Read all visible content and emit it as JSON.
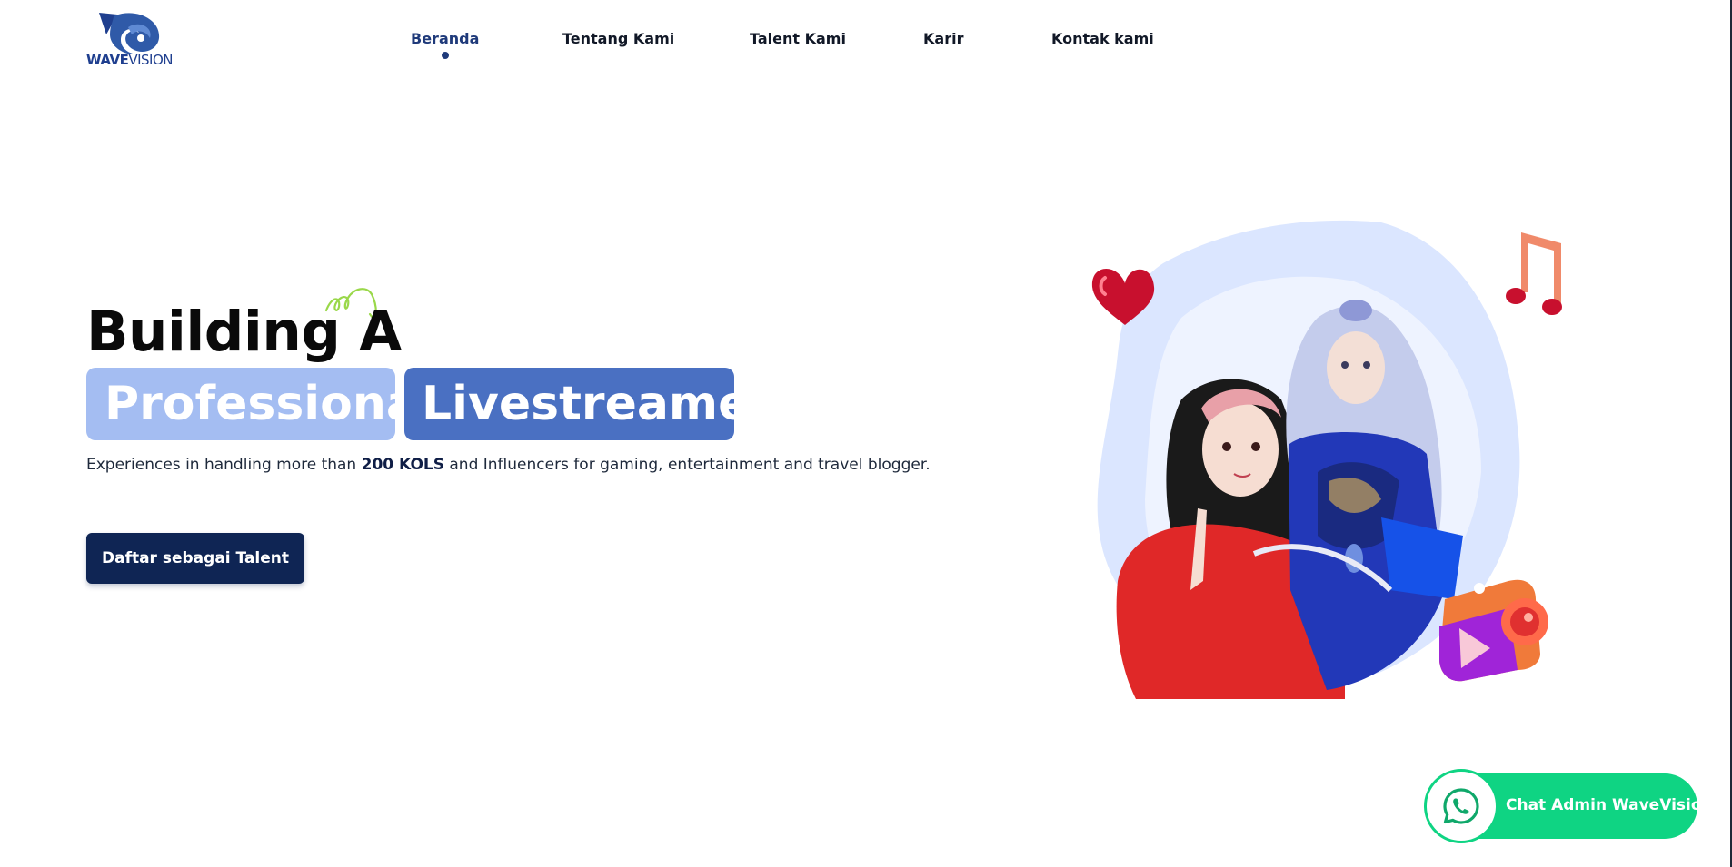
{
  "brand": {
    "logo_bold": "WAVE",
    "logo_light": "VISION",
    "color_primary": "#1f3a7a"
  },
  "nav": {
    "items": [
      {
        "label": "Beranda",
        "active": true
      },
      {
        "label": "Tentang Kami",
        "active": false
      },
      {
        "label": "Talent Kami",
        "active": false
      },
      {
        "label": "Karir",
        "active": false
      },
      {
        "label": "Kontak kami",
        "active": false
      }
    ]
  },
  "hero": {
    "title": "Building A",
    "tag_1": "Professional",
    "tag_2": "Livestreamer",
    "subtitle_pre": "Experiences in handling more than ",
    "subtitle_bold": "200 KOLS",
    "subtitle_post": " and Influencers for gaming, entertainment and travel blogger.",
    "cta_label": "Daftar sebagai Talent",
    "tag_1_color": "#a4bdf2",
    "tag_2_color": "#4a70c2",
    "cta_color": "#0f2554"
  },
  "illustration": {
    "icons": [
      "heart-icon",
      "music-note-icon",
      "camera-icon",
      "play-icon"
    ],
    "blob_color": "#dbe6ff"
  },
  "chat": {
    "label": "Chat Admin WaveVision",
    "icon": "whatsapp-icon",
    "color": "#0fd483"
  }
}
